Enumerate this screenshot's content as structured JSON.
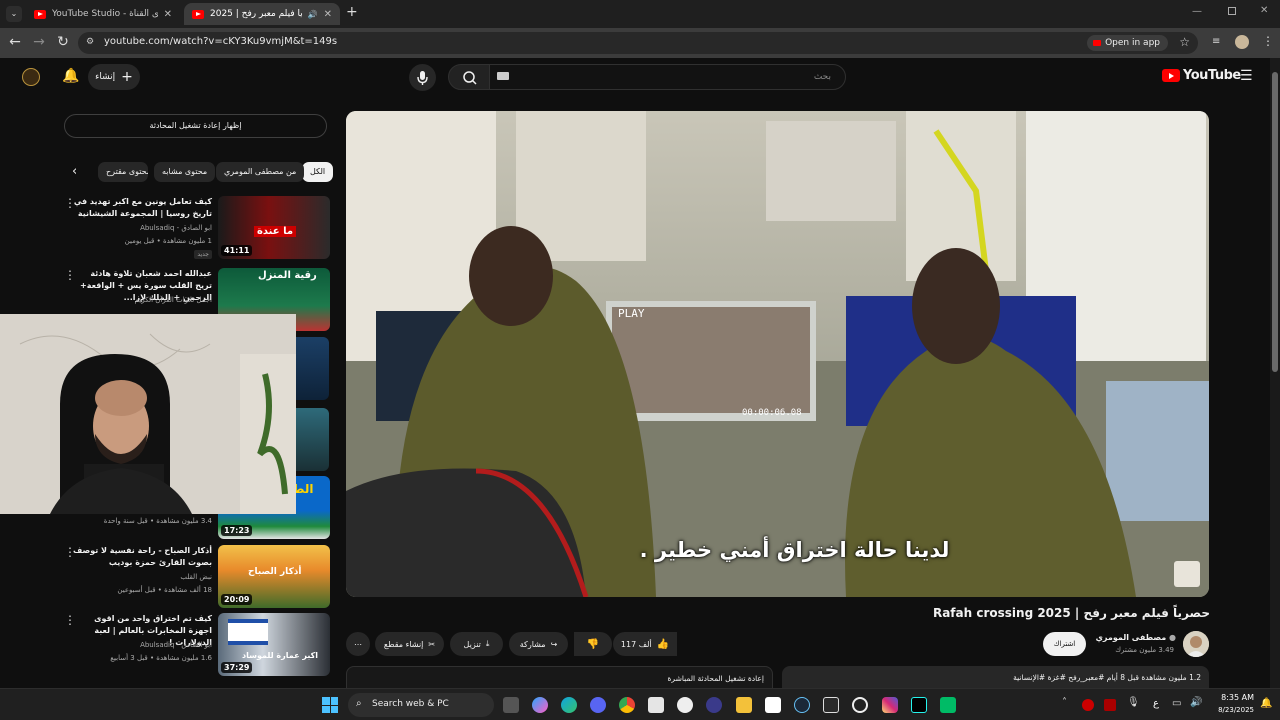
{
  "browser": {
    "tabs": [
      {
        "label": "YouTube Studio - محتوى القناة",
        "active": false
      },
      {
        "label": "حصرياً فيلم معبر رفح | 2025",
        "active": true
      }
    ],
    "new_tab_label": "+",
    "url": "youtube.com/watch?v=cKY3Ku9vmjM&t=149s",
    "open_in_app": "Open in app"
  },
  "youtube": {
    "logo_text": "YouTube",
    "search_placeholder": "بحث",
    "create_label": "إنشاء",
    "show_chat_replay": "إظهار إعادة تشغيل المحادثة",
    "chips": [
      {
        "label": "الكل",
        "active": true
      },
      {
        "label": "من مصطفى المومري",
        "active": false
      },
      {
        "label": "محتوى مشابه",
        "active": false
      },
      {
        "label": "محتوى مقترح",
        "active": false
      }
    ],
    "recommendations": [
      {
        "title": "كيف تعامل يونين مع اكبر تهديد في تاريخ روسيا | المجموعة الشيشانية",
        "channel": "ابو الصادق - Abulsadiq",
        "meta": "1 مليون مشاهدة • قبل يومين",
        "badge": "جديد",
        "duration": "41:11",
        "thumb_text": "ما عندة"
      },
      {
        "title": "عبدالله احمد شعبان تلاوة هادئة تريح القلب سورة يس + الواقعة+ الرحمن + الملك لإزا...",
        "channel": "أجمل تلاوات القرآن الكريم",
        "meta": "",
        "badge": "",
        "duration": "",
        "thumb_text": "رقية المنزل"
      },
      {
        "title": "",
        "channel": "",
        "meta": "3.4 مليون مشاهدة • قبل سنة واحدة",
        "badge": "",
        "duration": "17:23",
        "thumb_text": "الط"
      },
      {
        "title": "أذكار الصباح - راحة نفسية لا توصف بصوت القارئ حمزة بوديب",
        "channel": "نبض القلب",
        "meta": "18 ألف مشاهدة • قبل أسبوعين",
        "badge": "",
        "duration": "20:09",
        "thumb_text": "أذكار الصباح"
      },
      {
        "title": "كيف تم اختراق واحد من اقوى اجهزة المخابرات بالعالم | لعبة الدولارات !",
        "channel": "ابو الصادق - Abulsadiq",
        "meta": "1.6 مليون مشاهدة • قبل 3 أسابيع",
        "badge": "",
        "duration": "37:29",
        "thumb_text": "اكبر عمارة للموساد"
      }
    ],
    "video": {
      "subtitle": "لدينا حالة اختراق أمني خطير .",
      "screen_play": "PLAY",
      "screen_timecode": "00:00:06.08",
      "title": "حصرياً فيلم معبر رفح | Rafah crossing 2025",
      "channel_name": "مصطفى المومري",
      "channel_subs": "3.49 مليون مشترك",
      "subscribe_label": "اشتراك",
      "like_count": "117 ألف",
      "share_label": "مشاركة",
      "download_label": "تنزيل",
      "clip_label": "إنشاء مقطع",
      "more_label": "⋯",
      "description_stats": "1.2 مليون مشاهدة  قبل 8 أيام  #معبر_رفح #غزة #الإنسانية",
      "live_replay_label": "إعادة تشغيل المحادثة المباشرة"
    }
  },
  "taskbar": {
    "search_label": "Search web & PC",
    "time": "8:35 AM",
    "date": "8/23/2025",
    "lang": "ع"
  },
  "colors": {
    "yt_red": "#ff0000",
    "bg": "#0f0f0f",
    "chip_bg": "#272727"
  }
}
